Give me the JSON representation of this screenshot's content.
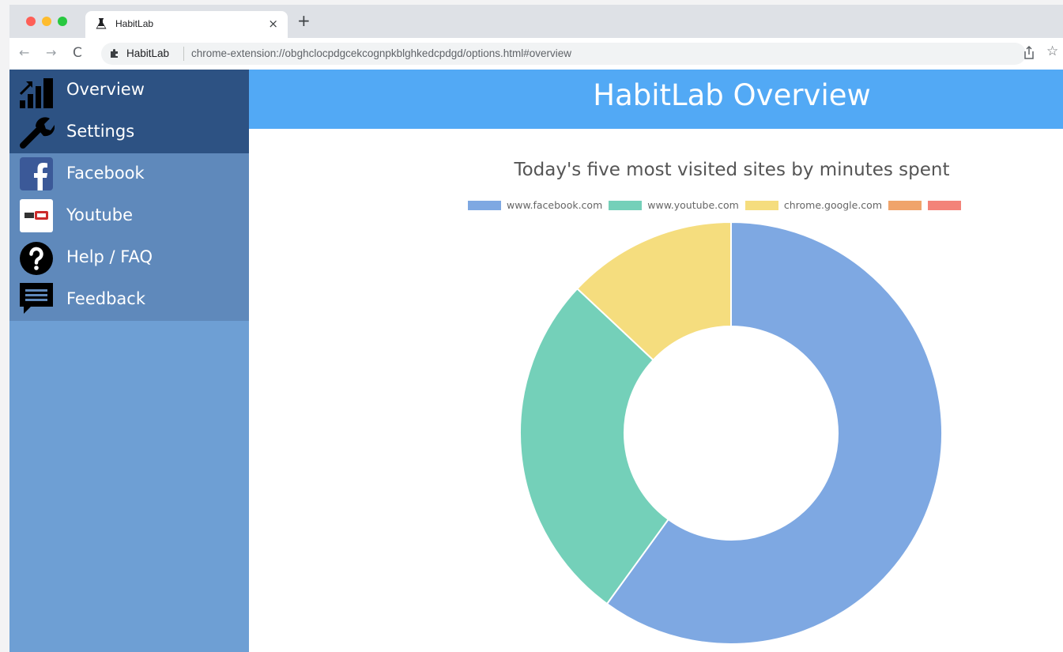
{
  "browser": {
    "tab_title": "HabitLab",
    "tab_close": "×",
    "new_tab": "+",
    "nav": {
      "back": "←",
      "forward": "→",
      "reload": "C"
    },
    "omnibox": {
      "site_label": "HabitLab",
      "url": "chrome-extension://obghclocpdgcekcognpkblghkedcpdgd/options.html#overview"
    },
    "star": "☆"
  },
  "sidebar": {
    "items": [
      {
        "label": "Overview",
        "icon": "bar-chart-icon"
      },
      {
        "label": "Settings",
        "icon": "wrench-icon"
      },
      {
        "label": "Facebook",
        "icon": "facebook-icon"
      },
      {
        "label": "Youtube",
        "icon": "youtube-icon"
      },
      {
        "label": "Help / FAQ",
        "icon": "help-icon"
      },
      {
        "label": "Feedback",
        "icon": "feedback-icon"
      }
    ],
    "active_color": "#2d5283",
    "site_color": "#5f89bb",
    "background_color": "#6e9fd4"
  },
  "header": {
    "title": "HabitLab Overview",
    "color": "#52a9f5"
  },
  "chart_data": {
    "type": "pie",
    "donut": true,
    "title": "Today's five most visited sites by minutes spent",
    "legend_position": "top",
    "categories": [
      "www.facebook.com",
      "www.youtube.com",
      "chrome.google.com",
      "",
      ""
    ],
    "values": [
      60,
      27,
      13,
      0,
      0
    ],
    "colors": [
      "#7ea8e2",
      "#74d0b9",
      "#f5dd7e",
      "#f0a46b",
      "#f38379"
    ]
  }
}
